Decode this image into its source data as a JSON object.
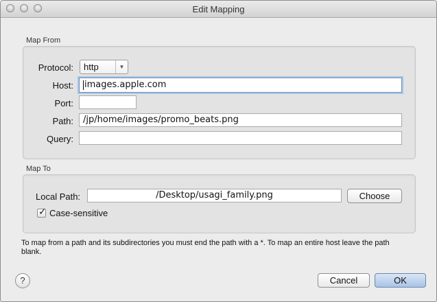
{
  "window": {
    "title": "Edit Mapping"
  },
  "map_from": {
    "section_label": "Map From",
    "protocol_label": "Protocol:",
    "protocol_value": "http",
    "host_label": "Host:",
    "host_value": "images.apple.com",
    "port_label": "Port:",
    "port_value": "",
    "path_label": "Path:",
    "path_value": "/jp/home/images/promo_beats.png",
    "query_label": "Query:",
    "query_value": ""
  },
  "map_to": {
    "section_label": "Map To",
    "local_path_label": "Local Path:",
    "local_path_value": "/Desktop/usagi_family.png",
    "choose_label": "Choose",
    "case_sensitive_label": "Case-sensitive",
    "case_sensitive_checked": true
  },
  "help_text": "To map from a path and its subdirectories you must end the path with a *. To map an entire host leave the path blank.",
  "footer": {
    "help_glyph": "?",
    "cancel_label": "Cancel",
    "ok_label": "OK"
  }
}
